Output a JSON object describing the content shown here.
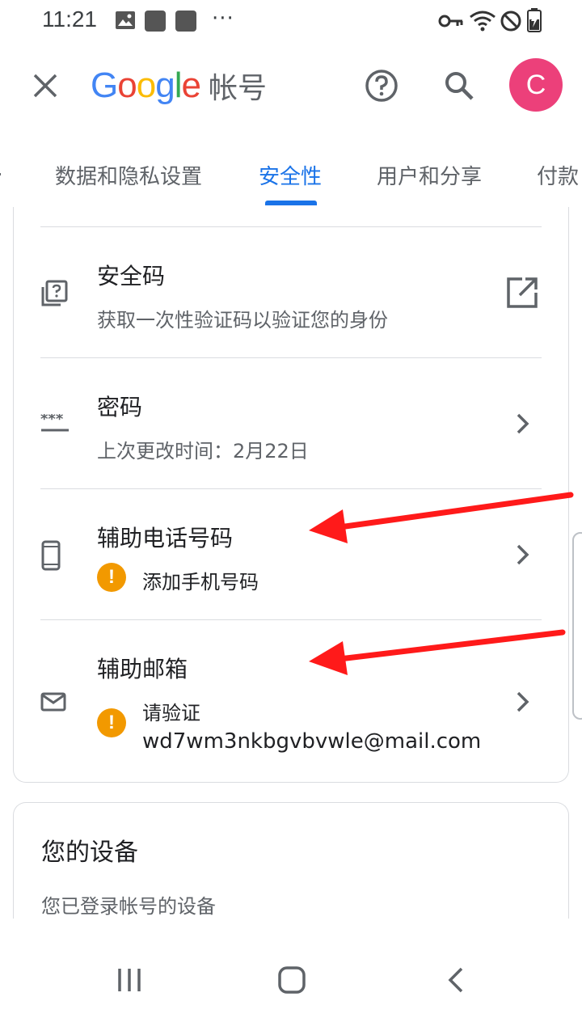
{
  "status_bar": {
    "time": "11:21",
    "more": "···",
    "icons": [
      "image-icon",
      "app-square-icon",
      "app-square-icon",
      "key-icon",
      "wifi-icon",
      "do-not-disturb-icon",
      "battery-charging-icon"
    ]
  },
  "app_bar": {
    "brand_letters": [
      "G",
      "o",
      "o",
      "g",
      "l",
      "e"
    ],
    "brand_title": "帐号",
    "avatar_letter": "C",
    "colors": {
      "blue": "#4285F4",
      "red": "#EA4335",
      "yellow": "#FBBC05",
      "green": "#34A853",
      "avatar": "#ec407a"
    }
  },
  "tabs": [
    {
      "label": "数据和隐私设置",
      "active": false
    },
    {
      "label": "安全性",
      "active": true
    },
    {
      "label": "用户和分享",
      "active": false
    },
    {
      "label": "付款",
      "active": false
    }
  ],
  "security": {
    "items": [
      {
        "title": "安全码",
        "subtitle": "获取一次性验证码以验证您的身份",
        "icon": "security-code-icon",
        "action": "open-in-new-icon"
      },
      {
        "title": "密码",
        "subtitle": "上次更改时间：2月22日",
        "icon": "password-icon",
        "action": "chevron-right-icon"
      },
      {
        "title": "辅助电话号码",
        "warning": "添加手机号码",
        "icon": "phone-icon",
        "action": "chevron-right-icon"
      },
      {
        "title": "辅助邮箱",
        "warning": "请验证",
        "email": "wd7wm3nkbgvbvwle@mail.com",
        "icon": "mail-icon",
        "action": "chevron-right-icon"
      }
    ],
    "warning_symbol": "!",
    "warning_color": "#f29900"
  },
  "devices": {
    "title": "您的设备",
    "subtitle": "您已登录帐号的设备"
  },
  "accent_color": "#1a73e8",
  "annotation_color": "#ff1a1a"
}
